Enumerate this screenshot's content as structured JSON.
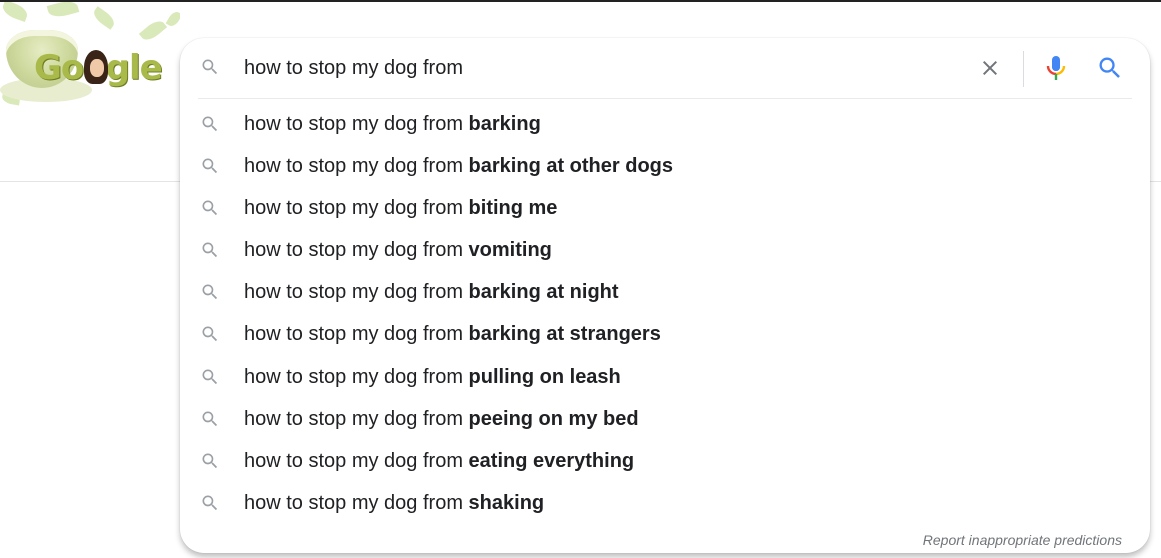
{
  "doodle": {
    "logo_text": "Google",
    "alt": "Google Doodle"
  },
  "search": {
    "query": "how to stop my dog from",
    "placeholder": "",
    "clear_icon": "close-icon",
    "mic_icon": "microphone-icon",
    "search_icon": "search-icon"
  },
  "suggestions": [
    {
      "prefix": "how to stop my dog from ",
      "completion": "barking"
    },
    {
      "prefix": "how to stop my dog from ",
      "completion": "barking at other dogs"
    },
    {
      "prefix": "how to stop my dog from ",
      "completion": "biting me"
    },
    {
      "prefix": "how to stop my dog from ",
      "completion": "vomiting"
    },
    {
      "prefix": "how to stop my dog from ",
      "completion": "barking at night"
    },
    {
      "prefix": "how to stop my dog from ",
      "completion": "barking at strangers"
    },
    {
      "prefix": "how to stop my dog from ",
      "completion": "pulling on leash"
    },
    {
      "prefix": "how to stop my dog from ",
      "completion": "peeing on my bed"
    },
    {
      "prefix": "how to stop my dog from ",
      "completion": "eating everything"
    },
    {
      "prefix": "how to stop my dog from ",
      "completion": "shaking"
    }
  ],
  "footer": {
    "report_label": "Report inappropriate predictions"
  },
  "colors": {
    "mic_blue": "#4285f4",
    "mic_red": "#ea4335",
    "mic_yellow": "#fbbc04",
    "mic_green": "#34a853",
    "search_blue": "#4285f4",
    "icon_gray": "#9aa0a6"
  }
}
